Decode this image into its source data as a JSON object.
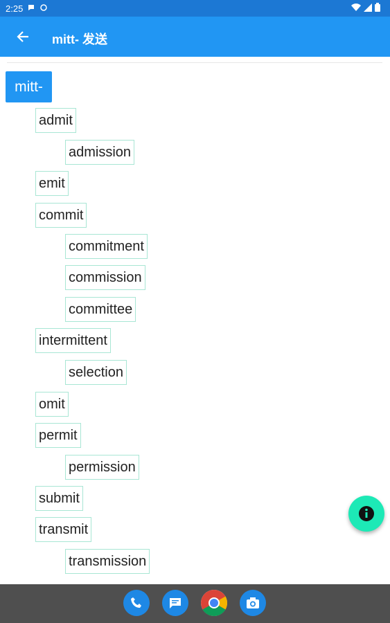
{
  "status_bar": {
    "time": "2:25",
    "notification_icons": [
      "chat-icon",
      "sync-icon"
    ],
    "system_icons": [
      "wifi-icon",
      "signal-icon",
      "battery-icon"
    ]
  },
  "app_bar": {
    "title": "mitt- 发送",
    "back_icon": "arrow-back-icon"
  },
  "tree": {
    "root": "mitt-",
    "nodes": [
      {
        "label": "admit",
        "level": 1
      },
      {
        "label": "admission",
        "level": 2
      },
      {
        "label": "emit",
        "level": 1
      },
      {
        "label": "commit",
        "level": 1
      },
      {
        "label": "commitment",
        "level": 2
      },
      {
        "label": "commission",
        "level": 2
      },
      {
        "label": "committee",
        "level": 2
      },
      {
        "label": "intermittent",
        "level": 1
      },
      {
        "label": "selection",
        "level": 2
      },
      {
        "label": "omit",
        "level": 1
      },
      {
        "label": "permit",
        "level": 1
      },
      {
        "label": "permission",
        "level": 2
      },
      {
        "label": "submit",
        "level": 1
      },
      {
        "label": "transmit",
        "level": 1
      },
      {
        "label": "transmission",
        "level": 2
      }
    ]
  },
  "fab": {
    "icon": "info-icon",
    "color": "#1de9b6"
  },
  "dock": {
    "apps": [
      "phone-icon",
      "messages-icon",
      "chrome-icon",
      "camera-icon"
    ]
  },
  "colors": {
    "primary": "#2196f3",
    "status_bar": "#1c78d4",
    "node_border": "#a8e6d4",
    "nav_bar": "#4f4f4f"
  }
}
